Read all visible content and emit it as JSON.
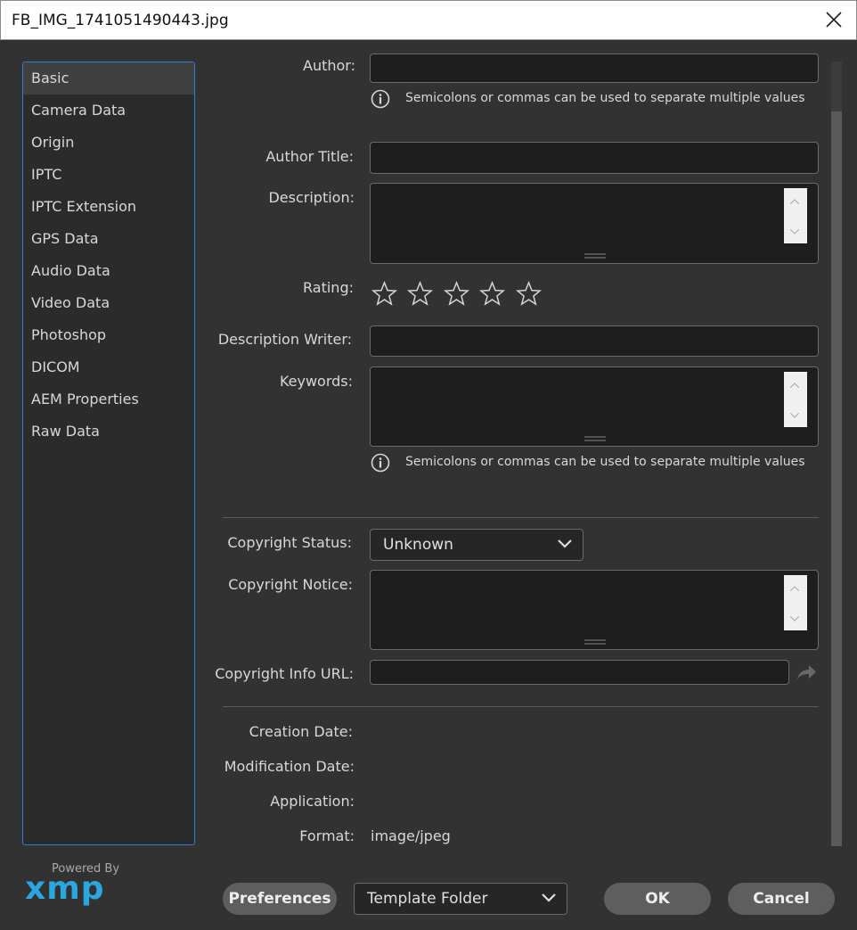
{
  "window": {
    "title": "FB_IMG_1741051490443.jpg"
  },
  "sidebar": {
    "items": [
      {
        "label": "Basic"
      },
      {
        "label": "Camera Data"
      },
      {
        "label": "Origin"
      },
      {
        "label": "IPTC"
      },
      {
        "label": "IPTC Extension"
      },
      {
        "label": "GPS Data"
      },
      {
        "label": "Audio Data"
      },
      {
        "label": "Video Data"
      },
      {
        "label": "Photoshop"
      },
      {
        "label": "DICOM"
      },
      {
        "label": "AEM Properties"
      },
      {
        "label": "Raw Data"
      }
    ],
    "selected": "Basic"
  },
  "branding": {
    "powered_by": "Powered By",
    "logo_text": "xmp",
    "logo_color": "#2aa7de"
  },
  "form": {
    "author_label": "Author:",
    "author_value": "",
    "author_hint": "Semicolons or commas can be used to separate multiple values",
    "author_title_label": "Author Title:",
    "description_label": "Description:",
    "rating_label": "Rating:",
    "rating_value": 0,
    "rating_max": 5,
    "description_writer_label": "Description Writer:",
    "keywords_label": "Keywords:",
    "keywords_hint": "Semicolons or commas can be used to separate multiple values",
    "copyright_status_label": "Copyright Status:",
    "copyright_status_value": "Unknown",
    "copyright_notice_label": "Copyright Notice:",
    "copyright_url_label": "Copyright Info URL:",
    "creation_date_label": "Creation Date:",
    "modification_date_label": "Modification Date:",
    "application_label": "Application:",
    "format_label": "Format:",
    "format_value": "image/jpeg"
  },
  "footer": {
    "preferences": "Preferences",
    "template_folder": "Template Folder",
    "ok": "OK",
    "cancel": "Cancel"
  }
}
